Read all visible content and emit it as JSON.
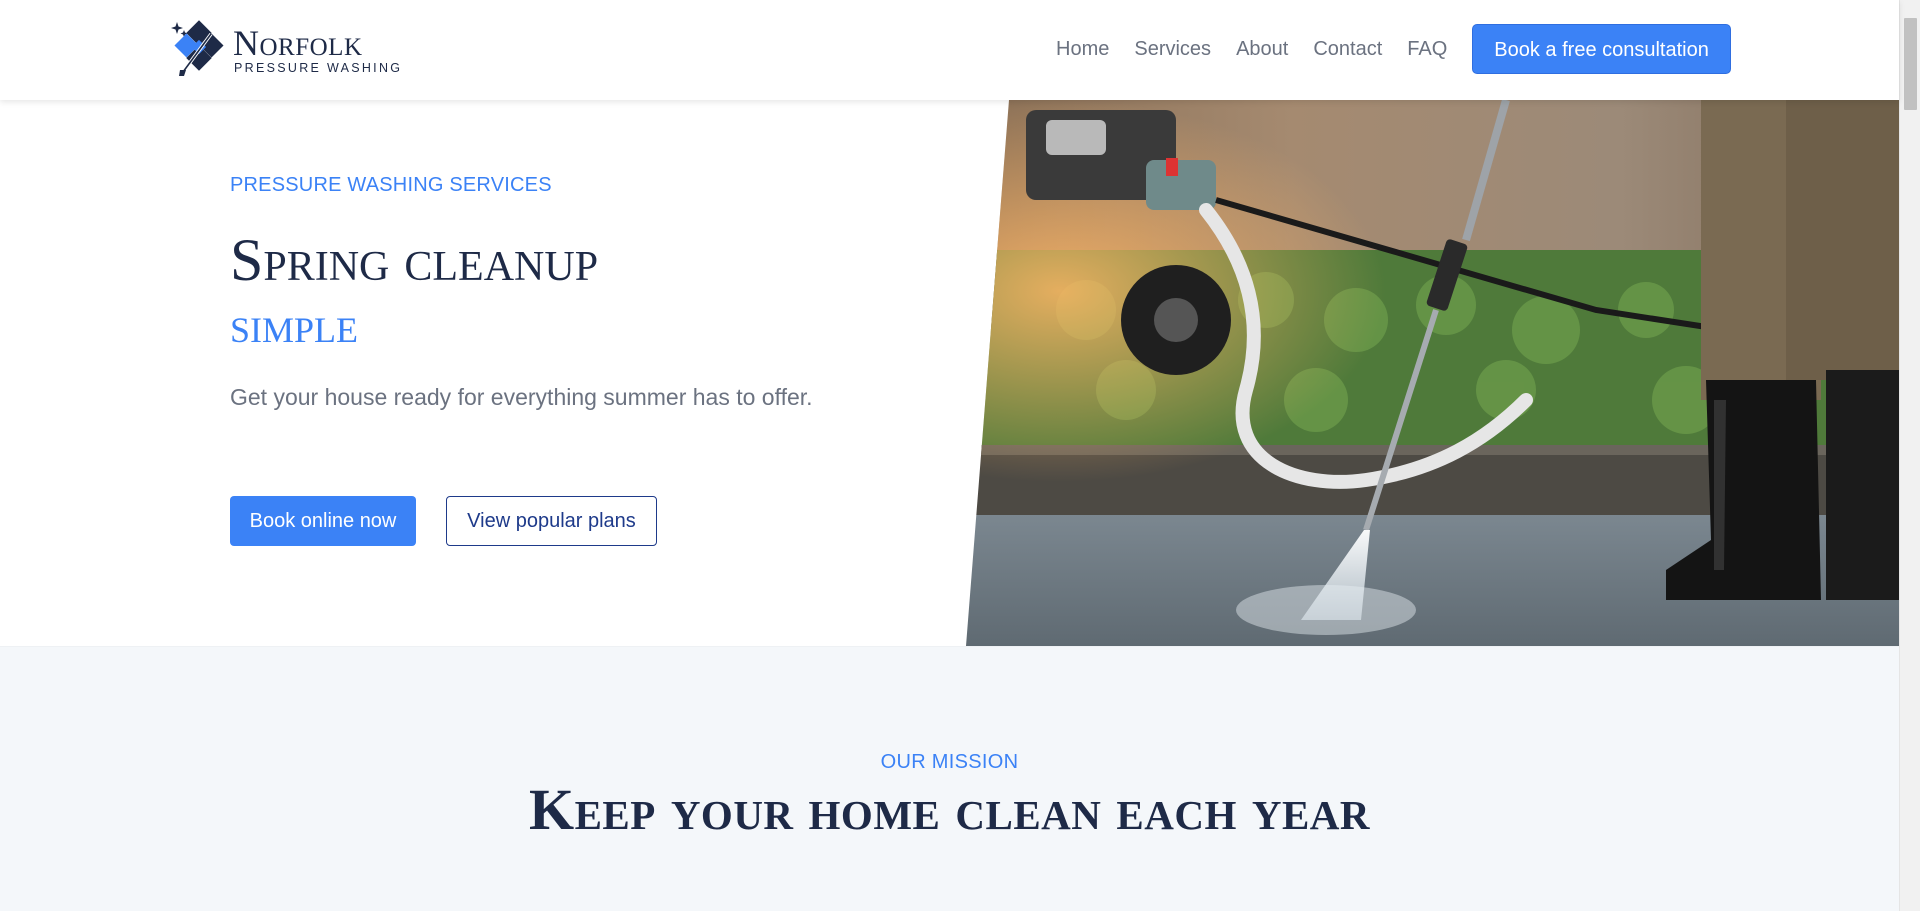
{
  "brand": {
    "name": "Norfolk",
    "tagline": "PRESSURE WASHING"
  },
  "nav": {
    "items": [
      {
        "label": "Home"
      },
      {
        "label": "Services"
      },
      {
        "label": "About"
      },
      {
        "label": "Contact"
      },
      {
        "label": "FAQ"
      }
    ],
    "cta_label": "Book a free consultation"
  },
  "hero": {
    "eyebrow": "PRESSURE WASHING SERVICES",
    "title": "Spring cleanup",
    "accent": "simple",
    "lead": "Get your house ready for everything summer has to offer.",
    "primary_button": "Book online now",
    "secondary_button": "View popular plans",
    "image_subject": "person pressure washing a concrete sidewalk"
  },
  "mission": {
    "eyebrow": "OUR MISSION",
    "title": "Keep your home clean each year"
  },
  "colors": {
    "accent": "#3b82f6",
    "navy": "#1e2a47",
    "muted_text": "#6b7280",
    "section_bg": "#f4f7fa"
  }
}
